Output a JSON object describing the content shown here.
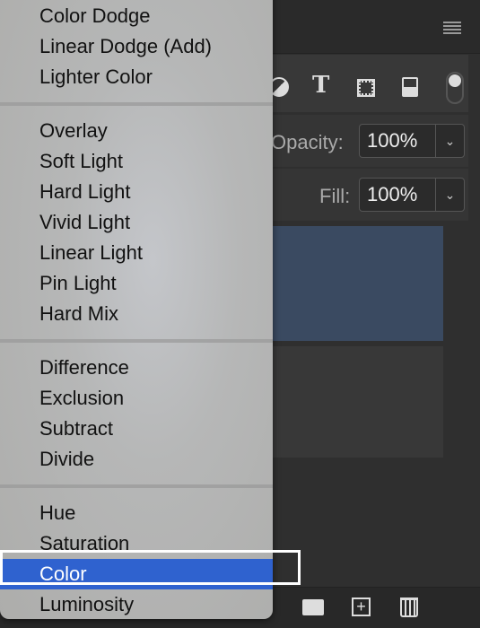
{
  "panel": {
    "opacity_label": "Opacity:",
    "opacity_value": "100%",
    "fill_label": "Fill:",
    "fill_value": "100%",
    "dropdown_glyph": "⌄",
    "filter_icons": [
      "adjustment-circle-icon",
      "type-icon",
      "shape-transform-icon",
      "smart-object-icon",
      "filter-toggle"
    ],
    "type_glyph": "T",
    "bottom_icons": [
      "folder-icon",
      "new-layer-icon",
      "trash-icon"
    ],
    "selected_layer_color": "#3a4a61"
  },
  "menu": {
    "groups": [
      [
        "Color Dodge",
        "Linear Dodge (Add)",
        "Lighter Color"
      ],
      [
        "Overlay",
        "Soft Light",
        "Hard Light",
        "Vivid Light",
        "Linear Light",
        "Pin Light",
        "Hard Mix"
      ],
      [
        "Difference",
        "Exclusion",
        "Subtract",
        "Divide"
      ],
      [
        "Hue",
        "Saturation",
        "Color",
        "Luminosity"
      ]
    ],
    "selected": "Color",
    "highlight_color": "#2f62cf"
  }
}
